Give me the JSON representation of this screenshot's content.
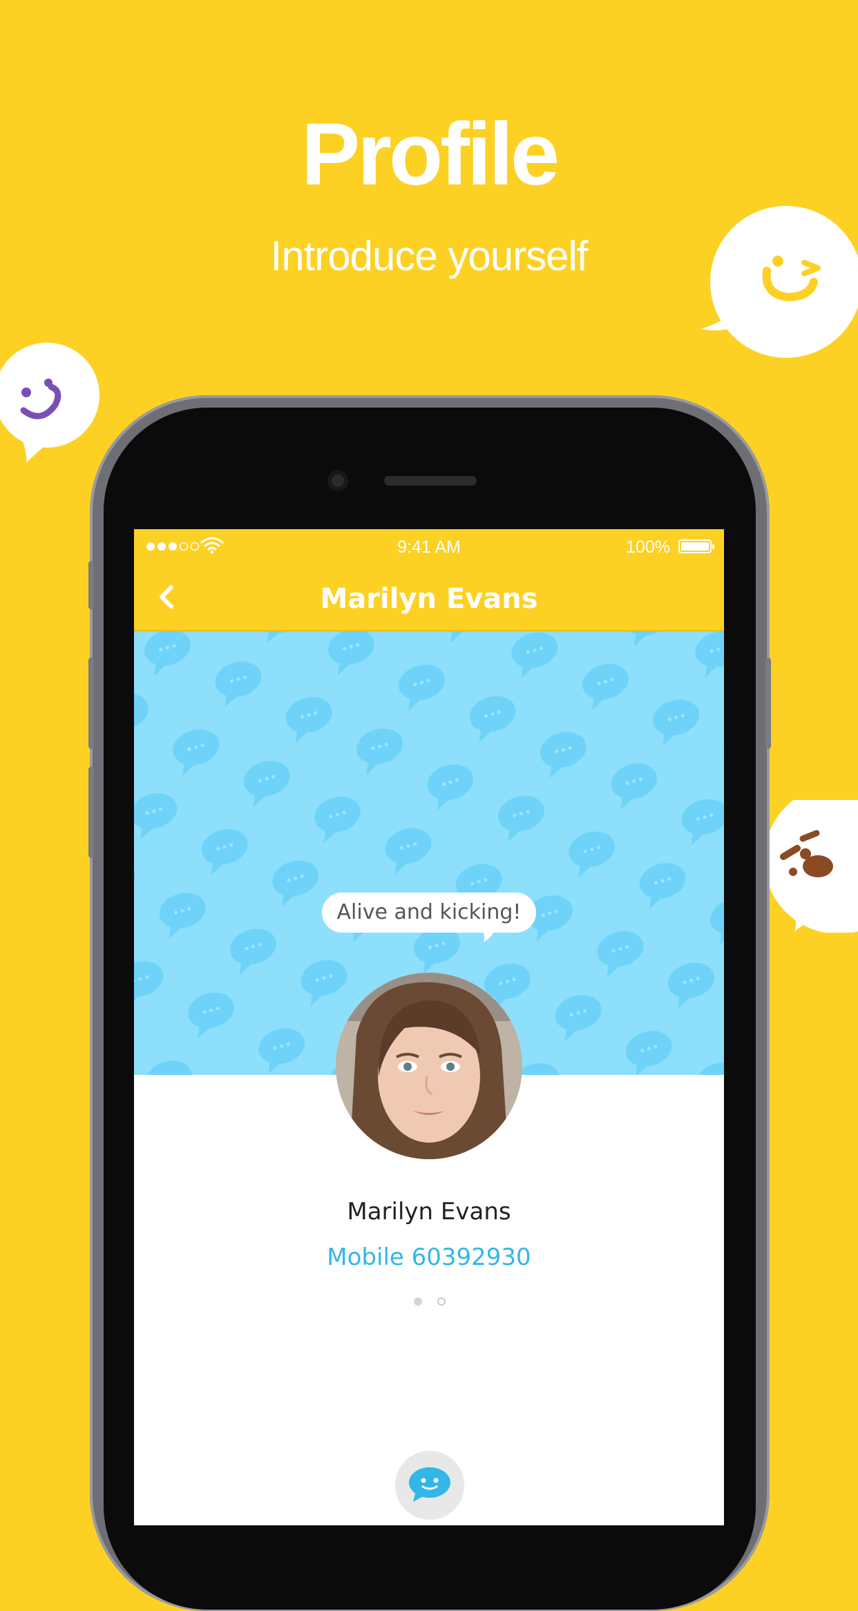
{
  "headline": {
    "title": "Profile",
    "subtitle": "Introduce yourself"
  },
  "status_bar": {
    "time": "9:41 AM",
    "battery": "100%"
  },
  "nav": {
    "title": "Marilyn Evans"
  },
  "profile": {
    "status_message": "Alive and kicking!",
    "name": "Marilyn Evans",
    "phone": "Mobile 60392930"
  },
  "pager": {
    "pages": 2,
    "active_index": 0
  },
  "icons": {
    "back": "chevron-left-icon",
    "chat": "chat-bubble-icon",
    "signal": "signal-dots-icon",
    "wifi": "wifi-icon",
    "battery": "battery-icon"
  },
  "colors": {
    "background": "#fdd124",
    "cover": "#8ddffb",
    "accent": "#33b6e8",
    "purple_emoji": "#7a4fb3",
    "brown_emoji": "#8a4a24"
  }
}
